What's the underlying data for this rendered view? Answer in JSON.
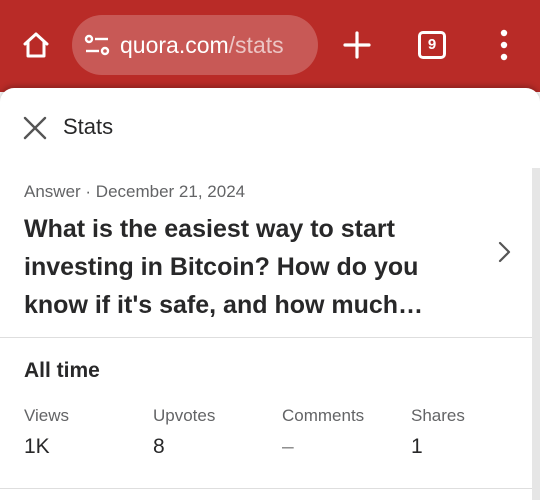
{
  "browser": {
    "url_host": "quora.com",
    "url_path": "/stats",
    "tab_count": "9"
  },
  "sheet": {
    "title": "Stats",
    "answer_meta": "Answer · December 21, 2024",
    "question": "What is the easiest way to start investing in Bitcoin? How do you know if it's safe, and how much…"
  },
  "stats": {
    "period": "All time",
    "items": [
      {
        "label": "Views",
        "value": "1K"
      },
      {
        "label": "Upvotes",
        "value": "8"
      },
      {
        "label": "Comments",
        "value": "–"
      },
      {
        "label": "Shares",
        "value": "1"
      }
    ]
  },
  "colors": {
    "brand": "#b92b27",
    "text_primary": "#282829",
    "text_secondary": "#636466"
  }
}
